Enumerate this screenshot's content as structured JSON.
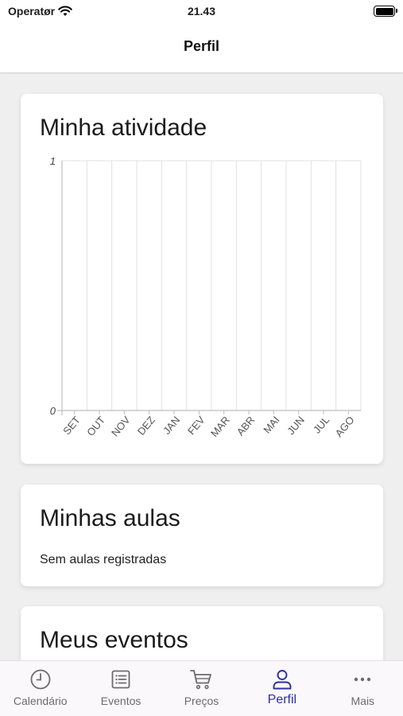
{
  "status_bar": {
    "carrier": "Operatør",
    "time": "21.43",
    "wifi_icon": "wifi-icon",
    "battery_icon": "battery-full-icon"
  },
  "nav": {
    "title": "Perfil"
  },
  "activity_card": {
    "title": "Minha atividade"
  },
  "chart_data": {
    "type": "line",
    "categories": [
      "SET",
      "OUT",
      "NOV",
      "DEZ",
      "JAN",
      "FEV",
      "MAR",
      "ABR",
      "MAI",
      "JUN",
      "JUL",
      "AGO"
    ],
    "series": [
      {
        "values": [
          0,
          0,
          0,
          0,
          0,
          0,
          0,
          0,
          0,
          0,
          0,
          0
        ]
      }
    ],
    "yticks": [
      0,
      1
    ],
    "ylim": [
      0,
      1
    ],
    "grid": true,
    "title": "",
    "xlabel": "",
    "ylabel": ""
  },
  "classes_card": {
    "title": "Minhas aulas",
    "empty_text": "Sem aulas registradas"
  },
  "events_card": {
    "title": "Meus eventos"
  },
  "tab_bar": {
    "accent_color": "#2c2fa6",
    "inactive_color": "#6b6b6b",
    "tabs": [
      {
        "label": "Calendário",
        "icon": "clock-icon",
        "active": false
      },
      {
        "label": "Eventos",
        "icon": "list-icon",
        "active": false
      },
      {
        "label": "Preços",
        "icon": "cart-icon",
        "active": false
      },
      {
        "label": "Perfil",
        "icon": "person-icon",
        "active": true
      },
      {
        "label": "Mais",
        "icon": "more-dots-icon",
        "active": false
      }
    ]
  }
}
